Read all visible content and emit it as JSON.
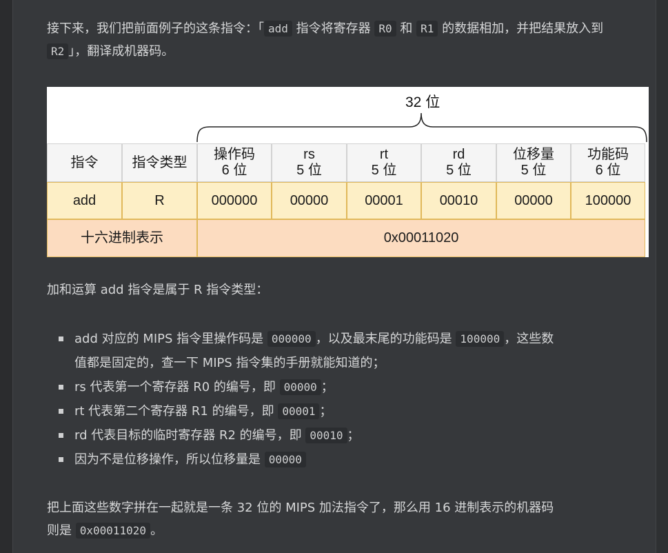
{
  "intro": {
    "part1": "接下来，我们把前面例子的这条指令：「",
    "code1": "add",
    "part2": " 指令将寄存器 ",
    "code2": "R0",
    "part3": " 和 ",
    "code3": "R1",
    "part4": " 的数据相加，并把结果放入到 ",
    "code4": "R2",
    "part5": "」，翻译成机器码。"
  },
  "figure": {
    "title": "32 位",
    "headers": [
      {
        "line1": "指令",
        "line2": ""
      },
      {
        "line1": "指令类型",
        "line2": ""
      },
      {
        "line1": "操作码",
        "line2": "6 位"
      },
      {
        "line1": "rs",
        "line2": "5 位"
      },
      {
        "line1": "rt",
        "line2": "5 位"
      },
      {
        "line1": "rd",
        "line2": "5 位"
      },
      {
        "line1": "位移量",
        "line2": "5 位"
      },
      {
        "line1": "功能码",
        "line2": "6 位"
      }
    ],
    "row": [
      "add",
      "R",
      "000000",
      "00000",
      "00001",
      "00010",
      "00000",
      "100000"
    ],
    "hex_label": "十六进制表示",
    "hex_value": "0x00011020"
  },
  "para2": "加和运算 add 指令是属于 R 指令类型：",
  "bullets": [
    {
      "pre": "add 对应的 MIPS 指令里操作码是 ",
      "code": "000000",
      "mid": "，以及最末尾的功能码是 ",
      "code2": "100000",
      "post": "，这些数",
      "line2": "值都是固定的，查一下 MIPS 指令集的手册就能知道的；"
    },
    {
      "pre": "rs 代表第一个寄存器 R0 的编号，即 ",
      "code": "00000",
      "post": "；"
    },
    {
      "pre": "rt 代表第二个寄存器 R1 的编号，即 ",
      "code": "00001",
      "post": "；"
    },
    {
      "pre": "rd 代表目标的临时寄存器 R2 的编号，即 ",
      "code": "00010",
      "post": "；"
    },
    {
      "pre": "因为不是位移操作，所以位移量是 ",
      "code": "00000",
      "post": ""
    }
  ],
  "para3": {
    "line1": "把上面这些数字拼在一起就是一条 32 位的 MIPS 加法指令了，那么用 16 进制表示的机器码",
    "pre2": "则是 ",
    "code": "0x00011020",
    "post2": "。"
  }
}
